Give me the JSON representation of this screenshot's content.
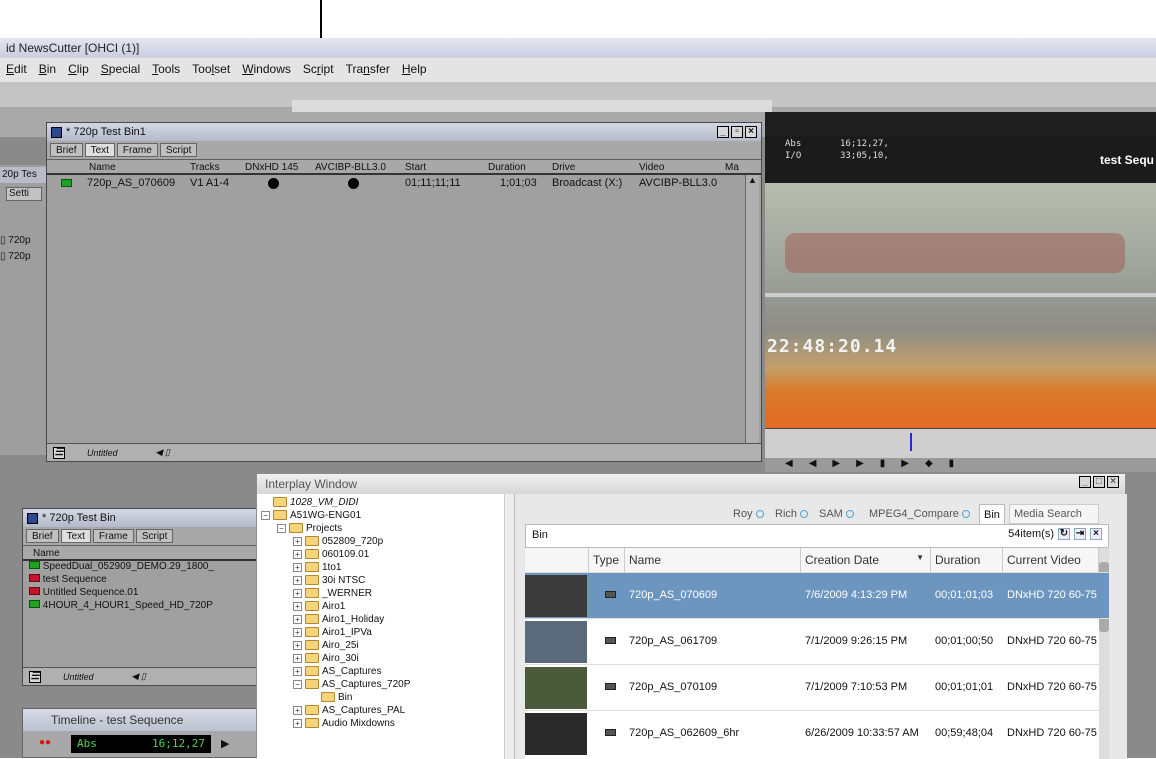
{
  "app": {
    "title": "id NewsCutter [OHCI (1)]"
  },
  "menu": [
    {
      "label": "Edit",
      "u": "E"
    },
    {
      "label": "Bin",
      "u": "B"
    },
    {
      "label": "Clip",
      "u": "C"
    },
    {
      "label": "Special",
      "u": "S"
    },
    {
      "label": "Tools",
      "u": "T"
    },
    {
      "label": "Toolset",
      "u": "l"
    },
    {
      "label": "Windows",
      "u": "W"
    },
    {
      "label": "Script",
      "u": "r"
    },
    {
      "label": "Transfer",
      "u": "n"
    },
    {
      "label": "Help",
      "u": "H"
    }
  ],
  "bin1": {
    "title": "* 720p Test Bin1",
    "tabs": [
      "Brief",
      "Text",
      "Frame",
      "Script"
    ],
    "columns": [
      "Name",
      "Tracks",
      "DNxHD 145",
      "AVCIBP-BLL3.0",
      "Start",
      "Duration",
      "Drive",
      "Video",
      "Ma"
    ],
    "rows": [
      {
        "name": "720p_AS_070609",
        "tracks": "V1 A1-4",
        "start": "01;11;11;11",
        "duration": "1;01;03",
        "drive": "Broadcast (X:)",
        "video": "AVCIBP-BLL3.0"
      }
    ],
    "footer": "Untitled"
  },
  "left_partial": {
    "tab": "20p Tes",
    "btn": "Setti",
    "items": [
      "720p",
      "720p"
    ]
  },
  "bin2": {
    "title": "* 720p Test Bin",
    "tabs": [
      "Brief",
      "Text",
      "Frame",
      "Script"
    ],
    "column": "Name",
    "rows": [
      {
        "name": "SpeedDual_052909_DEMO.29_1800_",
        "kind": "clip"
      },
      {
        "name": "test Sequence",
        "kind": "seq"
      },
      {
        "name": "Untitled Sequence.01",
        "kind": "seq"
      },
      {
        "name": "4HOUR_4_HOUR1_Speed_HD_720P",
        "kind": "clip"
      }
    ],
    "footer": "Untitled"
  },
  "monitor": {
    "abs_label": "Abs",
    "abs_value": "16;12,27,",
    "io_label": "I/O",
    "io_value": "33;05,10,",
    "title": "test Sequ",
    "timecode": "22:48:20.14"
  },
  "timeline": {
    "title": "Timeline - test Sequence",
    "abs_label": "Abs",
    "abs_value": "16;12,27"
  },
  "interplay": {
    "title": "Interplay Window",
    "tree": [
      {
        "label": "1028_VM_DIDI",
        "level": 0,
        "italic": true
      },
      {
        "label": "A51WG-ENG01",
        "level": 0
      },
      {
        "label": "Projects",
        "level": 1
      },
      {
        "label": "052809_720p",
        "level": 2
      },
      {
        "label": "060109.01",
        "level": 2
      },
      {
        "label": "1to1",
        "level": 2
      },
      {
        "label": "30i NTSC",
        "level": 2
      },
      {
        "label": "_WERNER",
        "level": 2
      },
      {
        "label": "Airo1",
        "level": 2
      },
      {
        "label": "Airo1_Holiday",
        "level": 2
      },
      {
        "label": "Airo1_IPVa",
        "level": 2
      },
      {
        "label": "Airo_25i",
        "level": 2
      },
      {
        "label": "Airo_30i",
        "level": 2
      },
      {
        "label": "AS_Captures",
        "level": 2
      },
      {
        "label": "AS_Captures_720P",
        "level": 2
      },
      {
        "label": "Bin",
        "level": 3
      },
      {
        "label": "AS_Captures_PAL",
        "level": 2
      },
      {
        "label": "Audio Mixdowns",
        "level": 2
      }
    ],
    "tabs": [
      "Roy",
      "Rich",
      "SAM",
      "MPEG4_Compare",
      "Bin",
      "Media Search"
    ],
    "bin_label": "Bin",
    "item_count": "54item(s)",
    "columns": [
      "Type",
      "Name",
      "Creation Date",
      "Duration",
      "Current Video"
    ],
    "rows": [
      {
        "name": "720p_AS_070609",
        "date": "7/6/2009 4:13:29 PM",
        "duration": "00;01;01;03",
        "video": "DNxHD 720 60-75"
      },
      {
        "name": "720p_AS_061709",
        "date": "7/1/2009 9:26:15 PM",
        "duration": "00;01;00;50",
        "video": "DNxHD 720 60-75"
      },
      {
        "name": "720p_AS_070109",
        "date": "7/1/2009 7:10:53 PM",
        "duration": "00;01;01;01",
        "video": "DNxHD 720 60-75"
      },
      {
        "name": "720p_AS_062609_6hr",
        "date": "6/26/2009 10:33:57 AM",
        "duration": "00;59;48;04",
        "video": "DNxHD 720 60-75"
      }
    ]
  }
}
